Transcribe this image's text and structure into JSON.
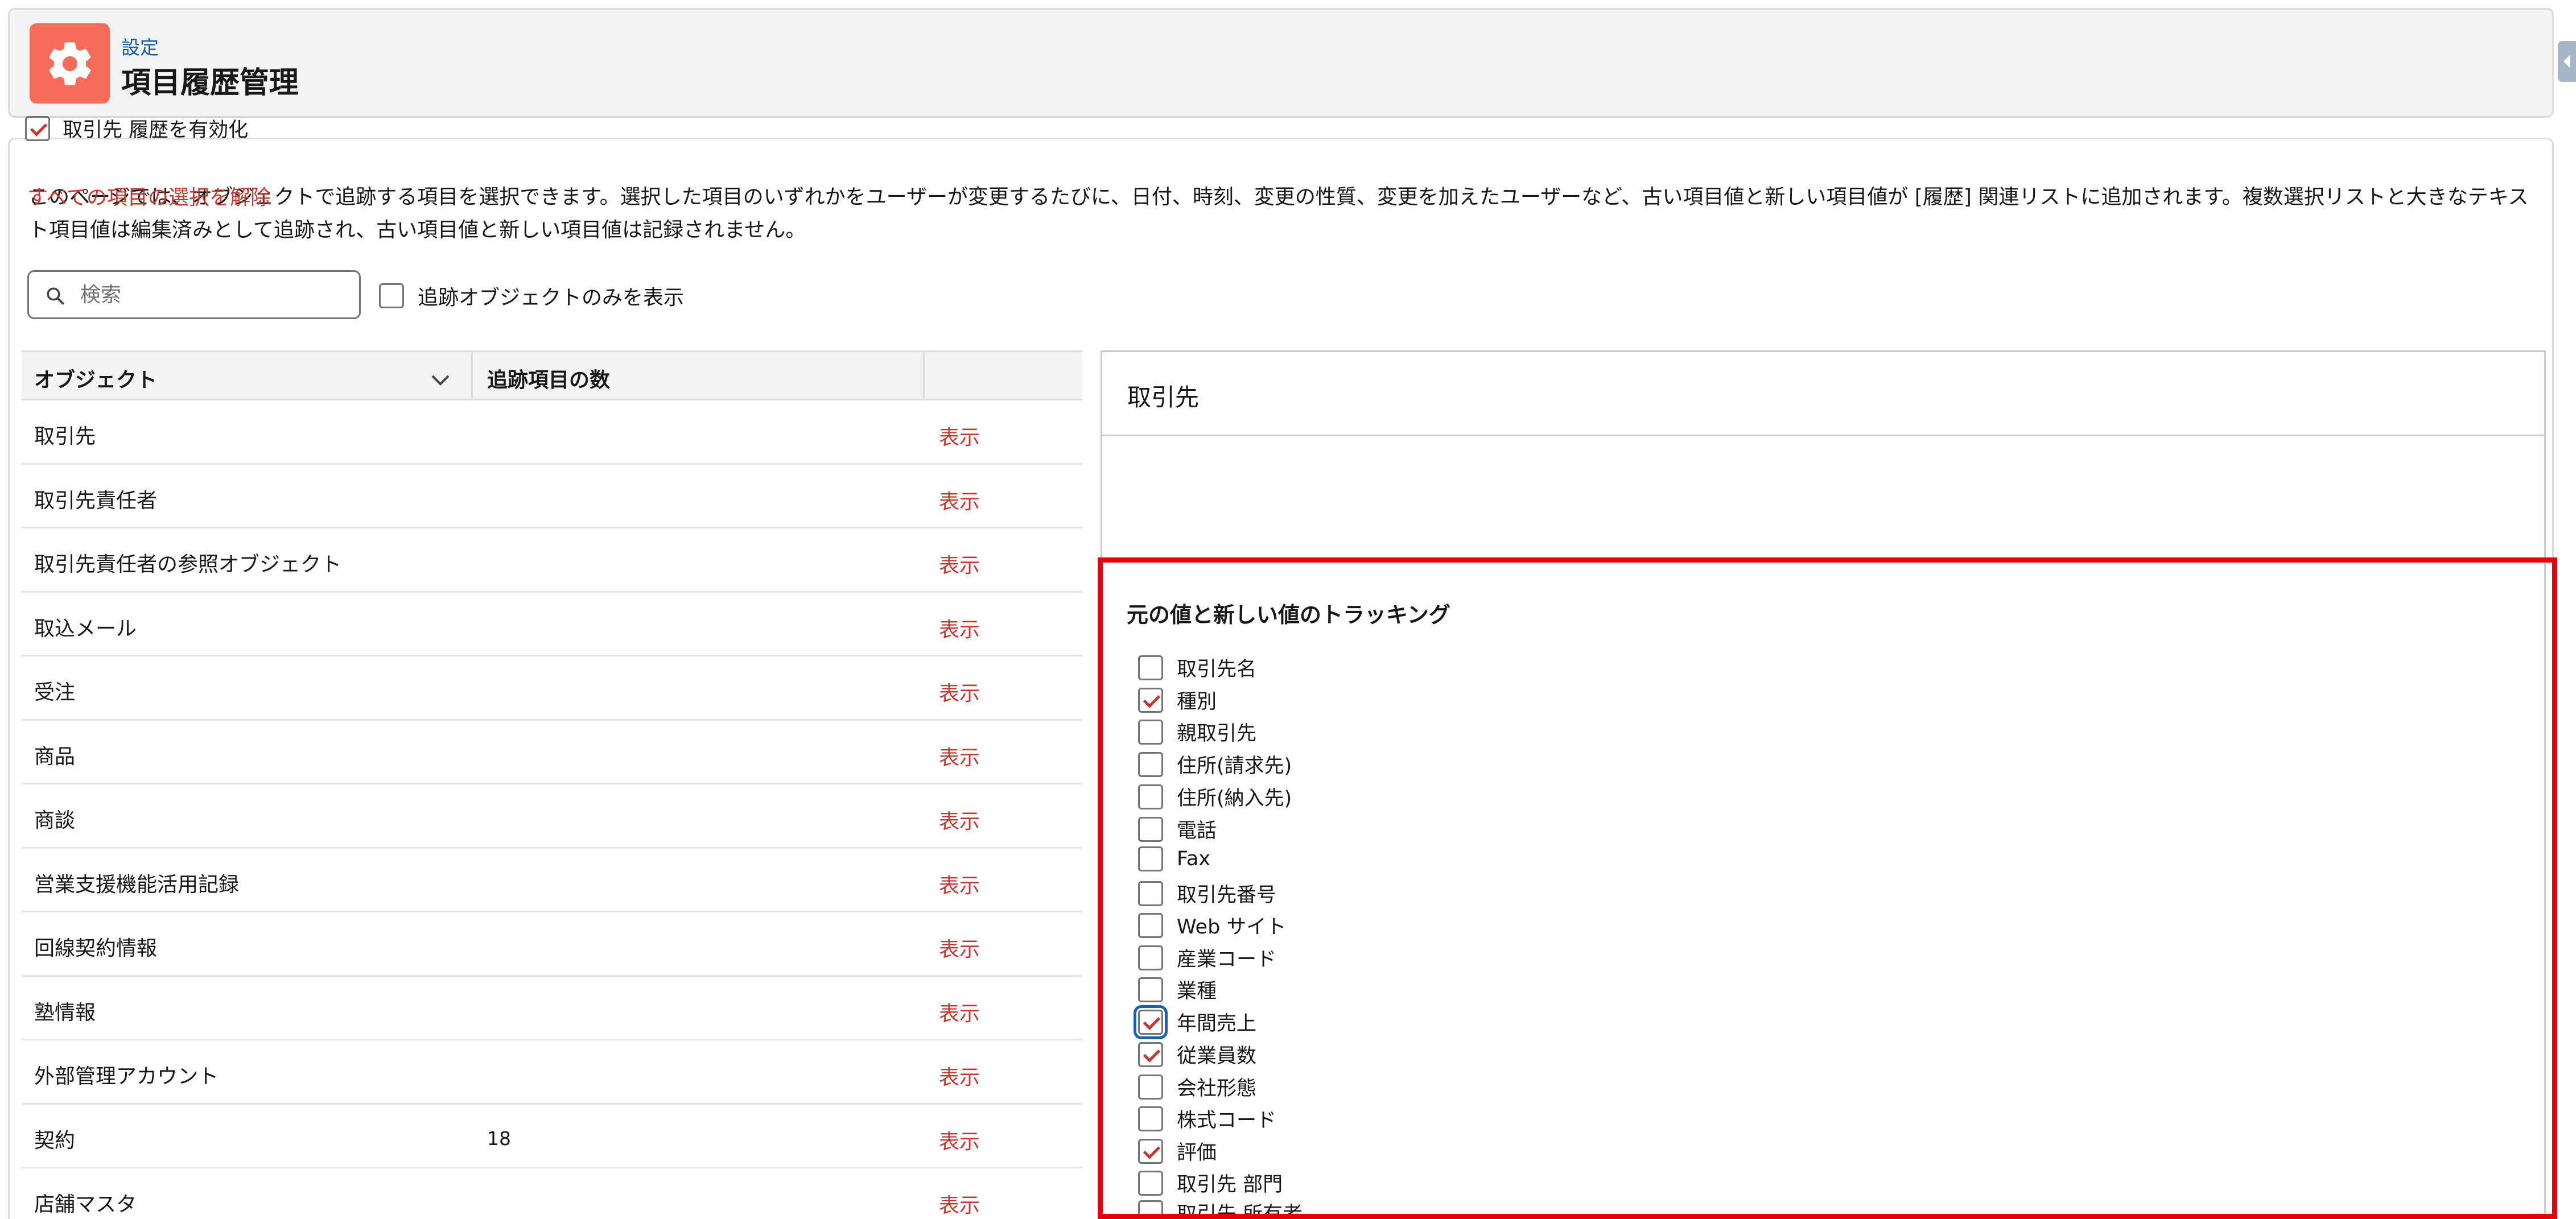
{
  "header": {
    "breadcrumb": "設定",
    "title": "項目履歴管理",
    "icon": "gear-icon",
    "icon_color": "#f66b5a"
  },
  "description": "このページでは、オブジェクトで追跡する項目を選択できます。選択した項目のいずれかをユーザーが変更するたびに、日付、時刻、変更の性質、変更を加えたユーザーなど、古い項目値と新しい項目値が [履歴] 関連リストに追加されます。複数選択リストと大きなテキスト項目値は編集済みとして追跡され、古い項目値と新しい項目値は記録されません。",
  "search": {
    "placeholder": "検索",
    "value": ""
  },
  "tracked_only": {
    "label": "追跡オブジェクトのみを表示",
    "checked": false
  },
  "object_table": {
    "columns": [
      "オブジェクト",
      "追跡項目の数"
    ],
    "rows": [
      {
        "name": "取引先",
        "count": "",
        "action": "表示"
      },
      {
        "name": "取引先責任者",
        "count": "",
        "action": "表示"
      },
      {
        "name": "取引先責任者の参照オブジェクト",
        "count": "",
        "action": "表示"
      },
      {
        "name": "取込メール",
        "count": "",
        "action": "表示"
      },
      {
        "name": "受注",
        "count": "",
        "action": "表示"
      },
      {
        "name": "商品",
        "count": "",
        "action": "表示"
      },
      {
        "name": "商談",
        "count": "",
        "action": "表示"
      },
      {
        "name": "営業支援機能活用記録",
        "count": "",
        "action": "表示"
      },
      {
        "name": "回線契約情報",
        "count": "",
        "action": "表示"
      },
      {
        "name": "塾情報",
        "count": "",
        "action": "表示"
      },
      {
        "name": "外部管理アカウント",
        "count": "",
        "action": "表示"
      },
      {
        "name": "契約",
        "count": "18",
        "action": "表示"
      },
      {
        "name": "店舗マスタ",
        "count": "",
        "action": "表示"
      }
    ]
  },
  "detail": {
    "title": "取引先",
    "enable_label": "取引先 履歴を有効化",
    "enable_checked": true,
    "deselect_all": "すべての項目の選択を解除",
    "tracking_title": "元の値と新しい値のトラッキング",
    "fields": [
      {
        "label": "取引先名",
        "checked": false
      },
      {
        "label": "種別",
        "checked": true
      },
      {
        "label": "親取引先",
        "checked": false
      },
      {
        "label": "住所(請求先)",
        "checked": false
      },
      {
        "label": "住所(納入先)",
        "checked": false
      },
      {
        "label": "電話",
        "checked": false
      },
      {
        "label": "Fax",
        "checked": false
      },
      {
        "label": "取引先番号",
        "checked": false
      },
      {
        "label": "Web サイト",
        "checked": false
      },
      {
        "label": "産業コード",
        "checked": false
      },
      {
        "label": "業種",
        "checked": false
      },
      {
        "label": "年間売上",
        "checked": true,
        "focused": true
      },
      {
        "label": "従業員数",
        "checked": true
      },
      {
        "label": "会社形態",
        "checked": false
      },
      {
        "label": "株式コード",
        "checked": false
      },
      {
        "label": "評価",
        "checked": true
      },
      {
        "label": "取引先 部門",
        "checked": false
      },
      {
        "label": "取引先 所有者",
        "checked": false
      }
    ]
  },
  "colors": {
    "link_red": "#c23934",
    "highlight_red": "#e8000b",
    "check_red": "#c23934"
  }
}
